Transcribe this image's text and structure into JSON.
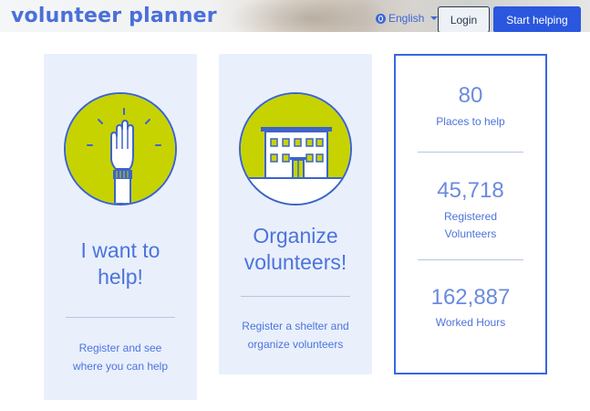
{
  "header": {
    "brand": "volunteer planner",
    "language": "English",
    "login_label": "Login",
    "start_label": "Start helping"
  },
  "cards": [
    {
      "title_line1": "I want to",
      "title_line2": "help!",
      "text_line1": "Register and see",
      "text_line2": "where you can help",
      "icon": "raised-hand-icon"
    },
    {
      "title_line1": "Organize",
      "title_line2": "volunteers!",
      "text_line1": "Register a shelter and",
      "text_line2": "organize volunteers",
      "icon": "building-icon"
    }
  ],
  "stats": [
    {
      "value": "80",
      "label_line1": "Places to help",
      "label_line2": ""
    },
    {
      "value": "45,718",
      "label_line1": "Registered",
      "label_line2": "Volunteers"
    },
    {
      "value": "162,887",
      "label_line1": "Worked Hours",
      "label_line2": ""
    }
  ],
  "colors": {
    "accent": "#2a57de",
    "text_blue": "#4d73dc",
    "card_bg": "#e9f0fc",
    "emblem_fill": "#c6d300",
    "emblem_dark": "#3d64c9"
  }
}
